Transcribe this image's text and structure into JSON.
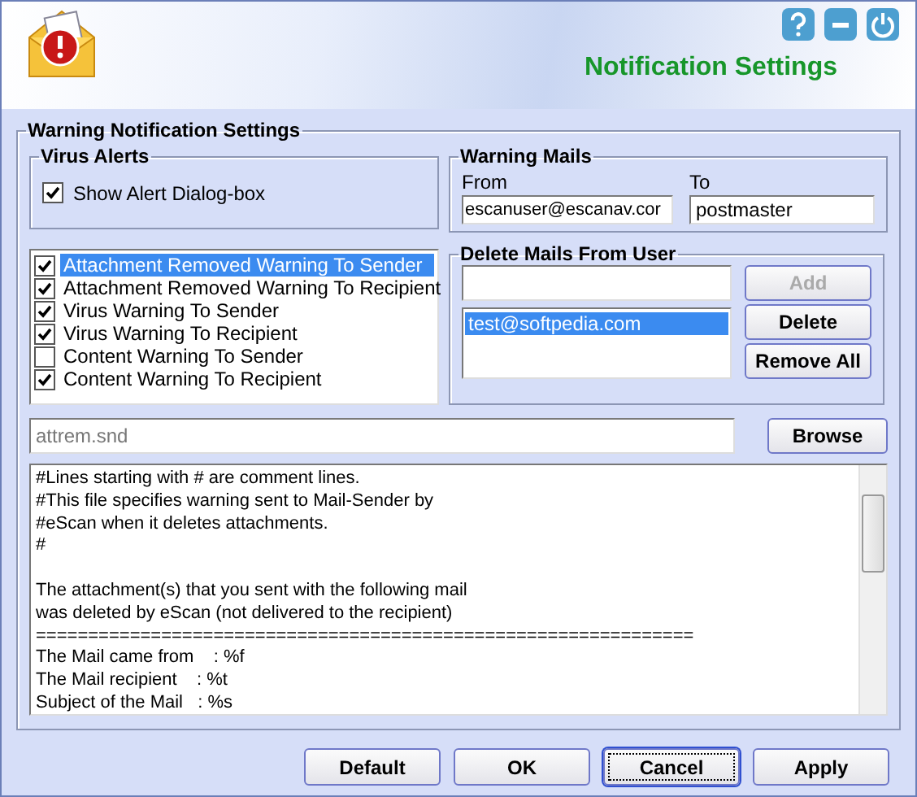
{
  "header": {
    "title": "Notification Settings"
  },
  "settings": {
    "legend": "Warning Notification Settings",
    "virus_alerts": {
      "legend": "Virus Alerts",
      "show_alert": {
        "label": "Show Alert Dialog-box",
        "checked": true
      }
    },
    "warning_mails": {
      "legend": "Warning Mails",
      "from": {
        "label": "From",
        "value": "escanuser@escanav.cor"
      },
      "to": {
        "label": "To",
        "value": "postmaster"
      }
    },
    "warnings": [
      {
        "label": "Attachment Removed Warning To Sender",
        "checked": true,
        "selected": true
      },
      {
        "label": "Attachment Removed Warning To Recipient",
        "checked": true,
        "selected": false
      },
      {
        "label": "Virus Warning To Sender",
        "checked": true,
        "selected": false
      },
      {
        "label": "Virus Warning To Recipient",
        "checked": true,
        "selected": false
      },
      {
        "label": "Content Warning To Sender",
        "checked": false,
        "selected": false
      },
      {
        "label": "Content Warning To Recipient",
        "checked": true,
        "selected": false
      }
    ],
    "delete_mails": {
      "legend": "Delete Mails From User",
      "users": [
        {
          "label": "test@softpedia.com",
          "selected": true
        }
      ],
      "buttons": [
        {
          "label": "Add",
          "disabled": true
        },
        {
          "label": "Delete",
          "disabled": false
        },
        {
          "label": "Remove All",
          "disabled": false
        }
      ]
    },
    "file": {
      "value": "attrem.snd",
      "disabled": true,
      "button": "Browse"
    },
    "message_lines": [
      {
        "text": "#Lines starting with # are comment lines.",
        "blank_before": false
      },
      {
        "text": "#This file specifies warning sent to Mail-Sender by",
        "blank_before": false
      },
      {
        "text": "#eScan when it deletes attachments.",
        "blank_before": false
      },
      {
        "text": "#",
        "blank_before": false
      },
      {
        "text": "The attachment(s) that you sent with the following mail",
        "blank_before": true
      },
      {
        "text": "was deleted by eScan (not delivered to the recipient)",
        "blank_before": false
      },
      {
        "text": "===============================================================",
        "blank_before": false
      },
      {
        "text": "The Mail came from    : %f",
        "blank_before": false
      },
      {
        "text": "The Mail recipient    : %t",
        "blank_before": false
      },
      {
        "text": "Subject of the Mail   : %s",
        "blank_before": false
      }
    ]
  },
  "buttons": [
    {
      "label": "Default",
      "focused": false
    },
    {
      "label": "OK",
      "focused": false
    },
    {
      "label": "Cancel",
      "focused": true
    },
    {
      "label": "Apply",
      "focused": false
    }
  ]
}
